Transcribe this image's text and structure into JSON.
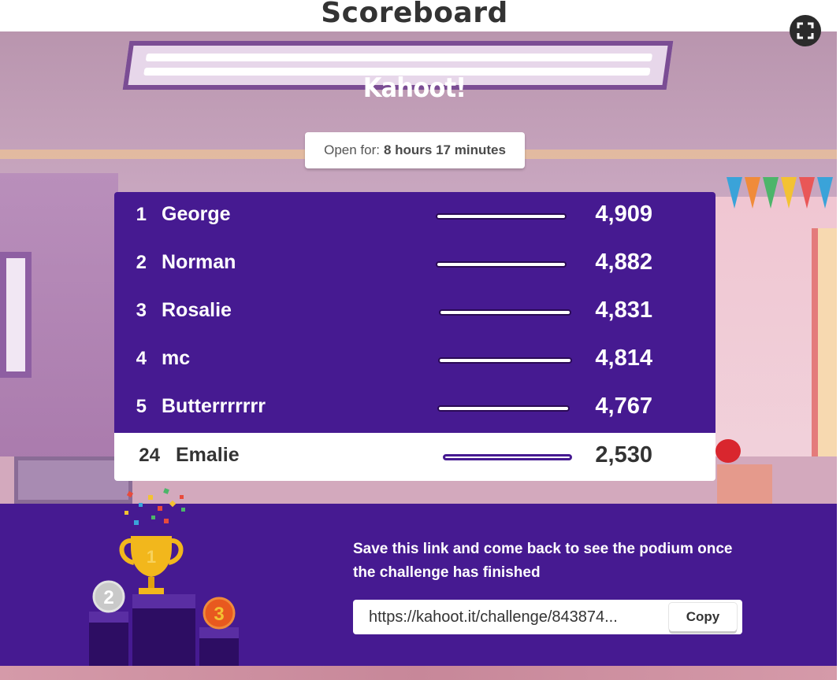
{
  "header": {
    "title": "Scoreboard"
  },
  "controls": {
    "fullscreen_icon": "fullscreen-icon"
  },
  "brand": {
    "logo_text": "Kahoot!"
  },
  "challenge": {
    "open_for_label": "Open for:",
    "open_for_value": "8 hours 17 minutes"
  },
  "leaderboard": [
    {
      "rank": "1",
      "name": "George",
      "score": "4,909"
    },
    {
      "rank": "2",
      "name": "Norman",
      "score": "4,882"
    },
    {
      "rank": "3",
      "name": "Rosalie",
      "score": "4,831"
    },
    {
      "rank": "4",
      "name": "mc",
      "score": "4,814"
    },
    {
      "rank": "5",
      "name": "Butterrrrrrr",
      "score": "4,767"
    }
  ],
  "current_player": {
    "rank": "24",
    "name": "Emalie",
    "score": "2,530"
  },
  "footer": {
    "save_message": "Save this link and come back to see the podium once the challenge has finished",
    "link_value": "https://kahoot.it/challenge/843874...",
    "copy_label": "Copy"
  },
  "colors": {
    "brand_purple": "#461a91",
    "white": "#ffffff",
    "text_dark": "#333333",
    "gold": "#f2b71c",
    "silver": "#c9c9c9",
    "bronze": "#e8591f"
  },
  "podium": {
    "first": "1",
    "second": "2",
    "third": "3"
  }
}
